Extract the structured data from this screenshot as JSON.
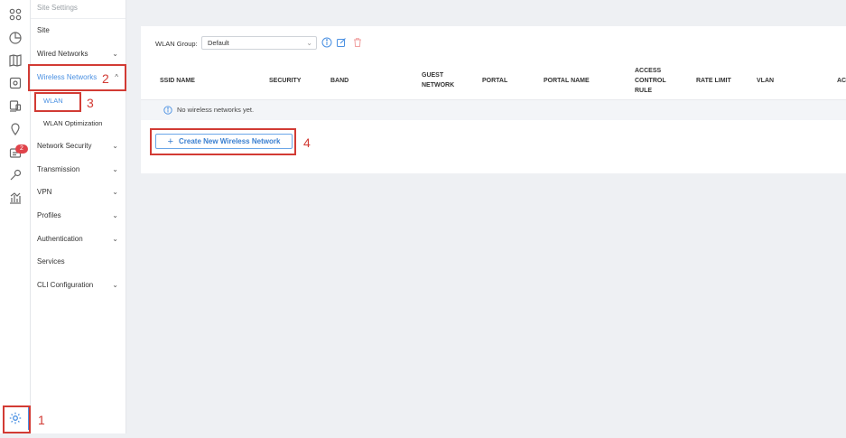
{
  "sidebar_header": "Site Settings",
  "menu": {
    "site": "Site",
    "wired_networks": "Wired Networks",
    "wireless_networks": "Wireless Networks",
    "wlan": "WLAN",
    "wlan_optimization": "WLAN Optimization",
    "network_security": "Network Security",
    "transmission": "Transmission",
    "vpn": "VPN",
    "profiles": "Profiles",
    "authentication": "Authentication",
    "services": "Services",
    "cli_configuration": "CLI Configuration"
  },
  "rail": {
    "badge_count": "2",
    "icons": [
      "grid-icon",
      "dashboard-icon",
      "map-icon",
      "device-icon",
      "clients-icon",
      "location-icon",
      "alerts-icon",
      "tools-icon",
      "reports-icon",
      "settings-icon"
    ]
  },
  "toolbar": {
    "wlan_group_label": "WLAN Group:",
    "wlan_group_value": "Default"
  },
  "table": {
    "headers": [
      "SSID NAME",
      "SECURITY",
      "BAND",
      "GUEST NETWORK",
      "PORTAL",
      "PORTAL NAME",
      "ACCESS CONTROL RULE",
      "RATE LIMIT",
      "VLAN",
      "AC"
    ],
    "empty_text": "No wireless networks yet."
  },
  "create_button": "Create New Wireless Network",
  "annotations": [
    "1",
    "2",
    "3",
    "4"
  ],
  "colors": {
    "accent": "#4a90e2",
    "annotation": "#d23b34",
    "badge": "#e0434a"
  }
}
